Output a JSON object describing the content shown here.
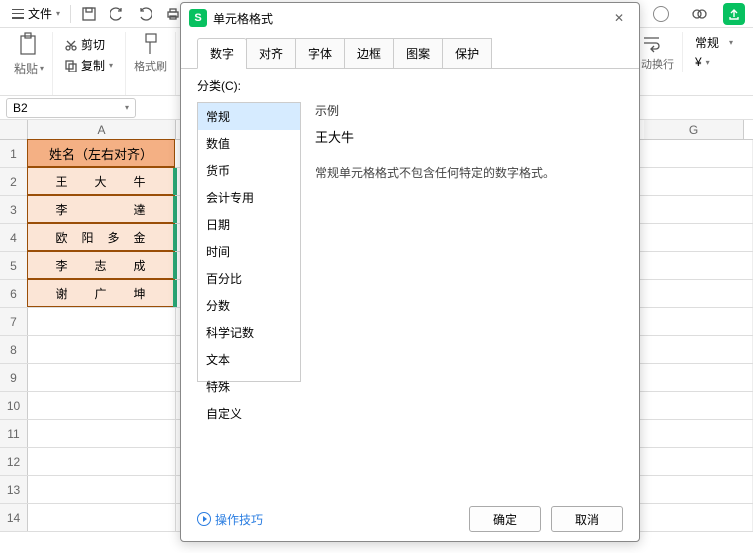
{
  "topbar": {
    "file_menu": "文件",
    "icons": [
      "save-icon",
      "undo-icon",
      "redo-icon",
      "print-icon"
    ]
  },
  "ribbon": {
    "paste": "粘贴",
    "cut": "剪切",
    "copy": "复制",
    "format_painter": "格式刷",
    "auto_wrap": "自动换行",
    "general": "常规",
    "currency_symbol": "¥"
  },
  "namebox": {
    "value": "B2"
  },
  "columns": {
    "A": "A",
    "G": "G"
  },
  "rows": [
    "1",
    "2",
    "3",
    "4",
    "5",
    "6",
    "7",
    "8",
    "9",
    "10",
    "11",
    "12",
    "13",
    "14"
  ],
  "table": {
    "header": "姓名（左右对齐）",
    "data": [
      "王　　大　　牛",
      "李　　　　　達",
      "欧　阳　多　金",
      "李　　志　　成",
      "谢　　广　　坤"
    ]
  },
  "dialog": {
    "title": "单元格格式",
    "close": "✕",
    "tabs": [
      "数字",
      "对齐",
      "字体",
      "边框",
      "图案",
      "保护"
    ],
    "active_tab": 0,
    "category_label": "分类(C):",
    "categories": [
      "常规",
      "数值",
      "货币",
      "会计专用",
      "日期",
      "时间",
      "百分比",
      "分数",
      "科学记数",
      "文本",
      "特殊",
      "自定义"
    ],
    "selected_category": 0,
    "sample_label": "示例",
    "sample_value": "王大牛",
    "description": "常规单元格格式不包含任何特定的数字格式。",
    "tips": "操作技巧",
    "ok": "确定",
    "cancel": "取消"
  }
}
